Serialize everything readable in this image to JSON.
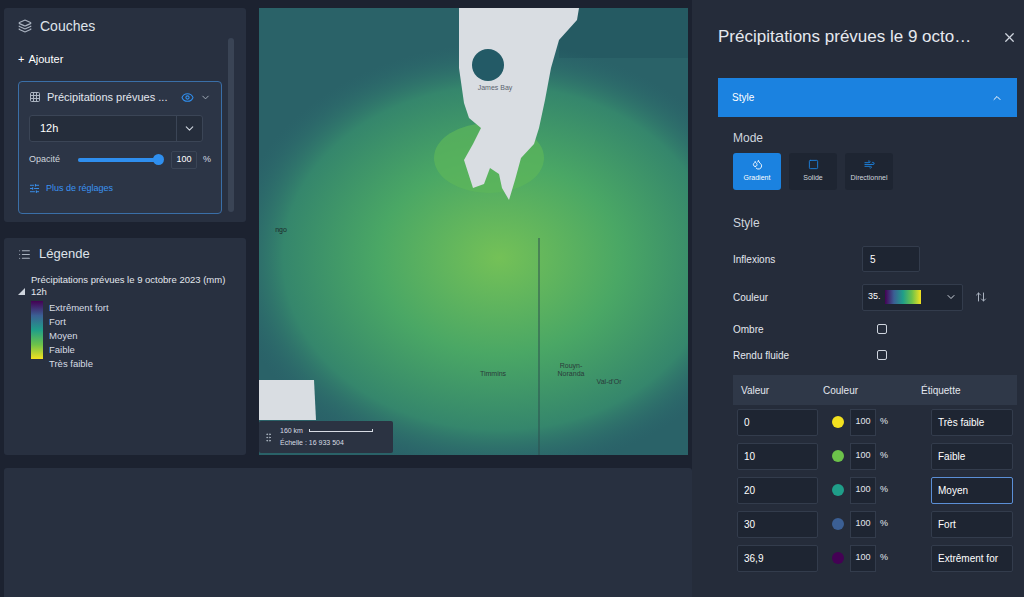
{
  "layers_panel": {
    "title": "Couches",
    "add_glyph": "+",
    "add_label": "Ajouter",
    "layer": {
      "name": "Précipitations prévues ...",
      "visible": true,
      "expanded": true,
      "time": "12h",
      "opacity_label": "Opacité",
      "opacity_level": 1,
      "opacity_value": "100",
      "opacity_unit": "%",
      "more": "Plus de réglages"
    }
  },
  "legend": {
    "title": "Légende",
    "expanded": true,
    "layer_title": "Précipitations prévues le 9 octobre 2023 (mm)",
    "time": "12h",
    "entries": [
      "Extrêment fort",
      "Fort",
      "Moyen",
      "Faible",
      "Très faible"
    ]
  },
  "map": {
    "labels": [
      "James Bay",
      "Timmins",
      "Rouyn-Noranda",
      "Val-d'Or",
      "ngo"
    ],
    "scale": {
      "distance": "160 km",
      "ratio": "Échelle : 16 933 504"
    }
  },
  "style_panel": {
    "title": "Précipitations prévues le 9 octo…",
    "section": {
      "title": "Style",
      "expanded": true
    },
    "mode_label": "Mode",
    "modes": [
      {
        "label": "Gradient",
        "selected": true
      },
      {
        "label": "Solide",
        "selected": false
      },
      {
        "label": "Directionnel",
        "selected": false
      }
    ],
    "style_label": "Style",
    "inflexions": {
      "label": "Inflexions",
      "value": "5"
    },
    "couleur": {
      "label": "Couleur",
      "value": "35."
    },
    "ombre": {
      "label": "Ombre",
      "checked": false
    },
    "rendu": {
      "label": "Rendu fluide",
      "checked": false
    },
    "table": {
      "columns": [
        "Valeur",
        "Couleur",
        "Étiquette"
      ],
      "rows": [
        {
          "value": "0",
          "color": "#f3e11f",
          "opacity": "100",
          "unit": "%",
          "label": "Très faible",
          "focused": false
        },
        {
          "value": "10",
          "color": "#6cc24a",
          "opacity": "100",
          "unit": "%",
          "label": "Faible",
          "focused": false
        },
        {
          "value": "20",
          "color": "#1f9e89",
          "opacity": "100",
          "unit": "%",
          "label": "Moyen",
          "focused": true
        },
        {
          "value": "30",
          "color": "#3b5f94",
          "opacity": "100",
          "unit": "%",
          "label": "Fort",
          "focused": false
        },
        {
          "value": "36,9",
          "color": "#440154",
          "opacity": "100",
          "unit": "%",
          "label": "Extrêment for",
          "focused": false
        }
      ]
    }
  }
}
